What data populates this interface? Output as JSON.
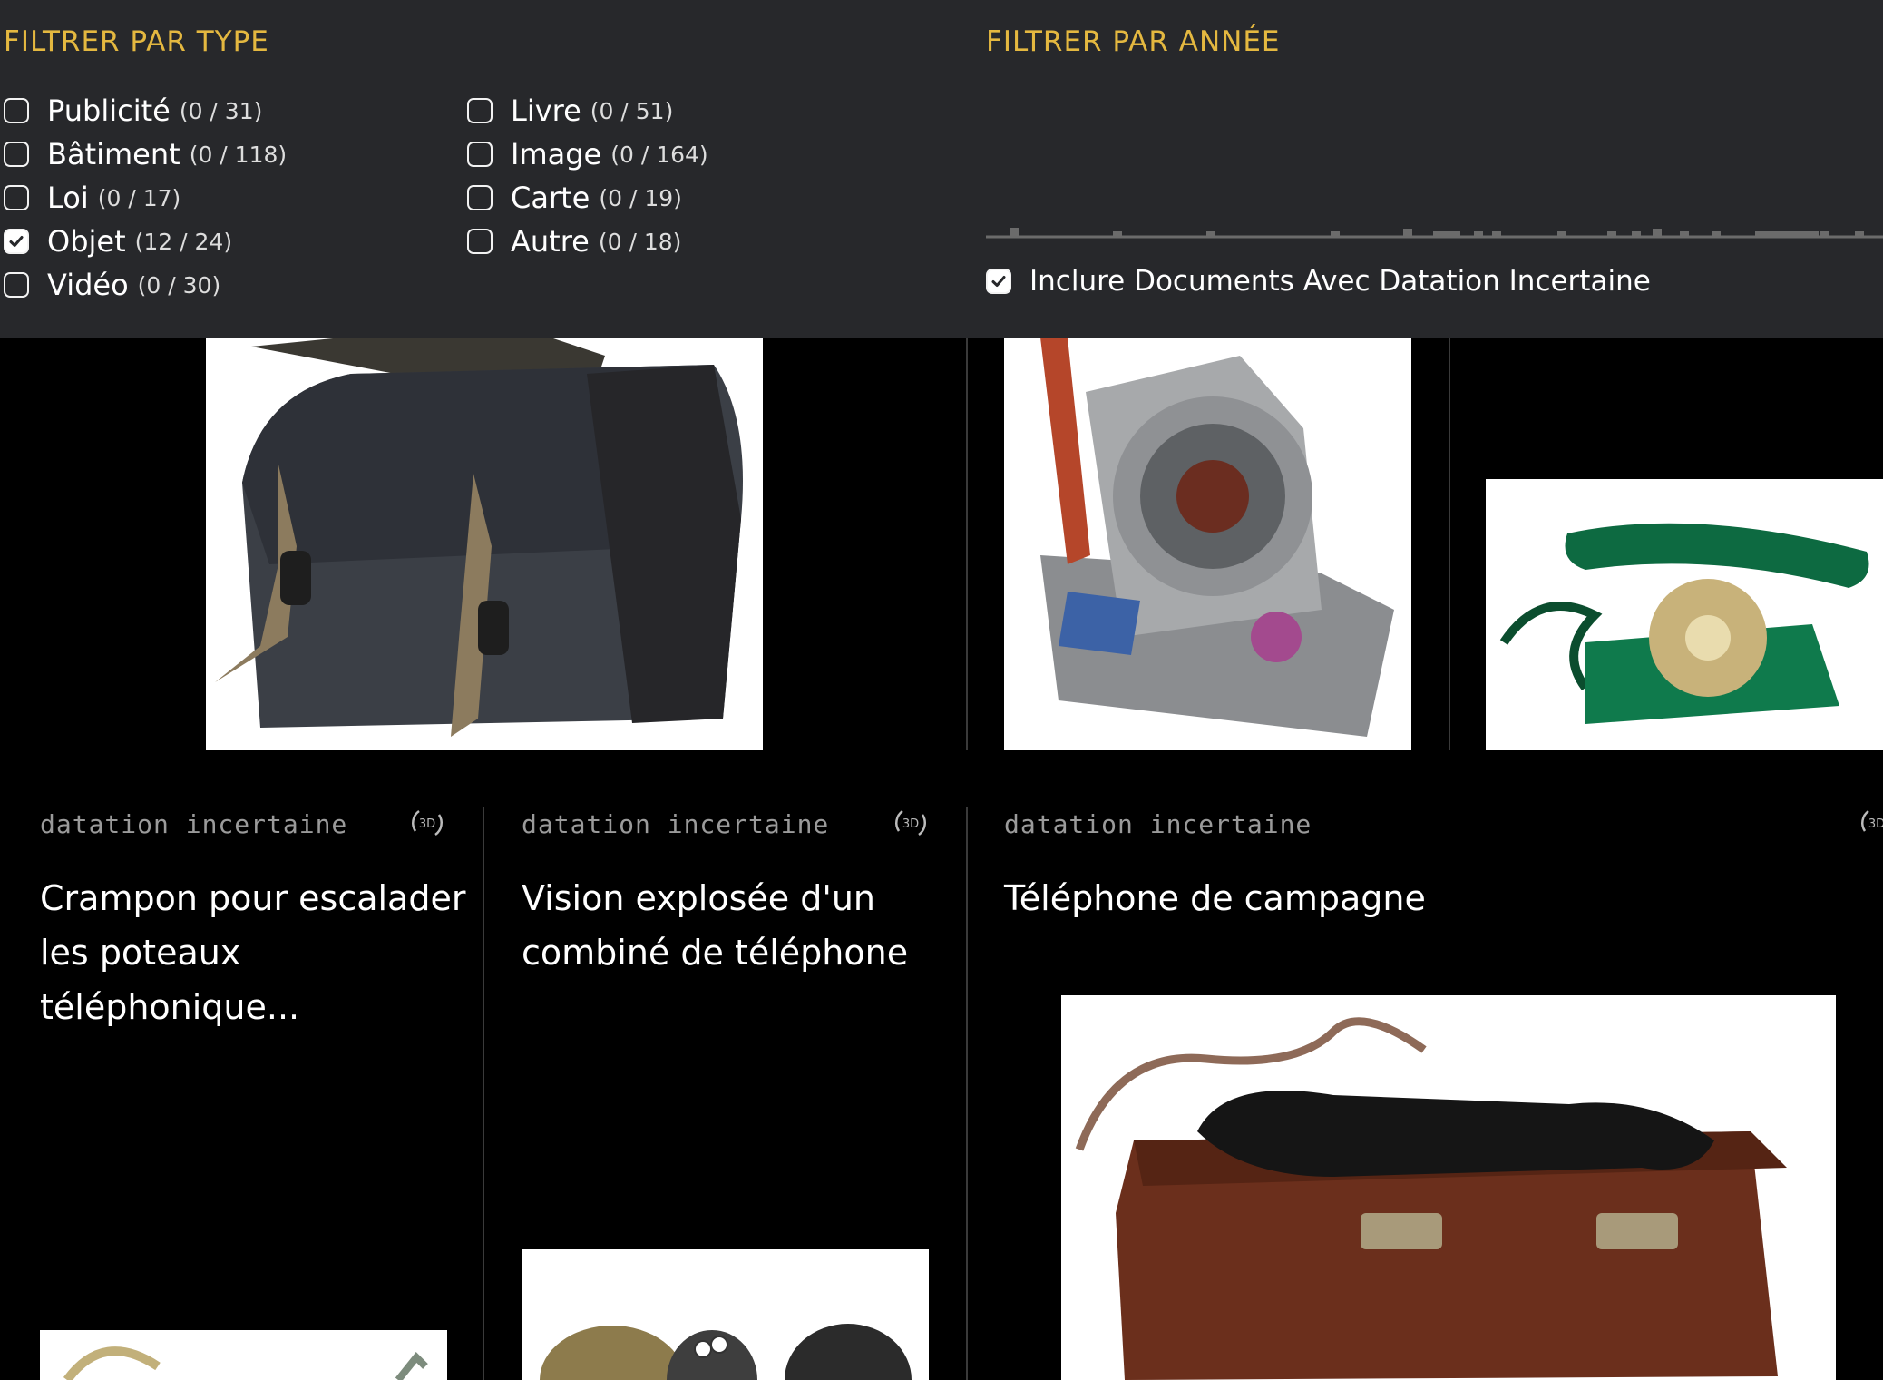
{
  "filters": {
    "type_title": "FILTRER PAR TYPE",
    "year_title": "FILTRER PAR ANNÉE",
    "types": [
      {
        "label": "Publicité",
        "count": "(0 / 31)",
        "checked": false
      },
      {
        "label": "Bâtiment",
        "count": "(0 / 118)",
        "checked": false
      },
      {
        "label": "Loi",
        "count": "(0 / 17)",
        "checked": false
      },
      {
        "label": "Objet",
        "count": "(12 / 24)",
        "checked": true
      },
      {
        "label": "Vidéo",
        "count": "(0 / 30)",
        "checked": false
      },
      {
        "label": "Livre",
        "count": "(0 / 51)",
        "checked": false
      },
      {
        "label": "Image",
        "count": "(0 / 164)",
        "checked": false
      },
      {
        "label": "Carte",
        "count": "(0 / 19)",
        "checked": false
      },
      {
        "label": "Autre",
        "count": "(0 / 18)",
        "checked": false
      }
    ],
    "include_uncertain": {
      "label": "Inclure Documents Avec Datation Incertaine",
      "checked": true
    }
  },
  "cards": [
    {
      "date": "datation incertaine",
      "badge": "3D",
      "title": "Crampon pour escalader les poteaux téléphonique..."
    },
    {
      "date": "datation incertaine",
      "badge": "3D",
      "title": "Vision explosée d'un combiné de téléphone"
    },
    {
      "date": "datation incertaine",
      "badge": "3D",
      "title": "Téléphone de campagne"
    }
  ],
  "colors": {
    "accent": "#e4b840",
    "panel": "#27282b",
    "background": "#000000"
  }
}
